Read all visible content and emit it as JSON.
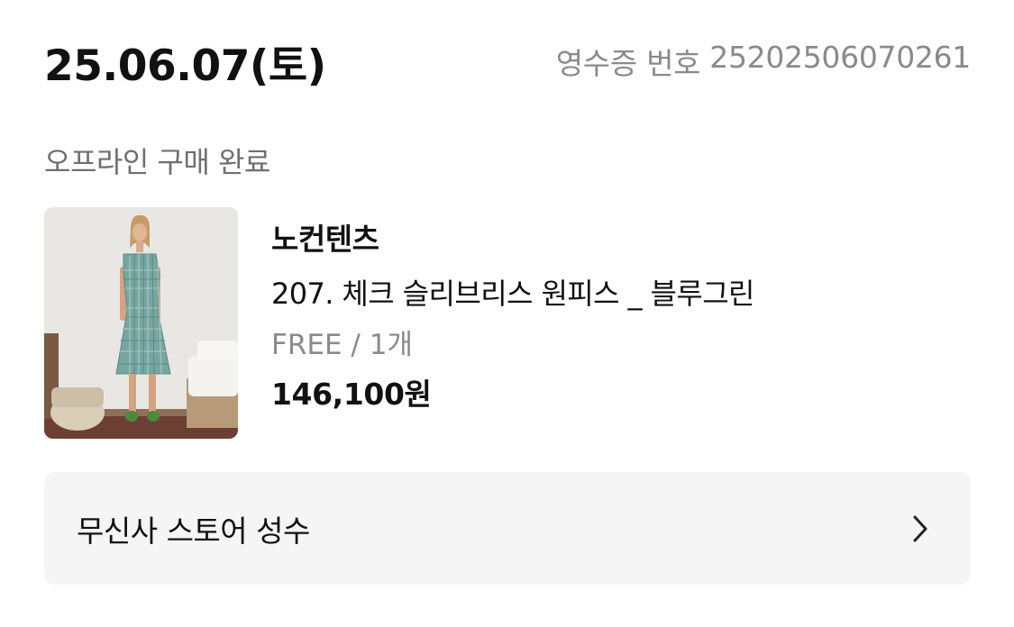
{
  "order": {
    "date": "25.06.07(토)",
    "receipt_label": "영수증 번호",
    "receipt_number": "25202506070261",
    "status": "오프라인 구매 완료"
  },
  "product": {
    "brand": "노컨텐츠",
    "name": "207. 체크 슬리브리스 원피스 _ 블루그린",
    "option_size": "FREE",
    "option_separator": "/",
    "option_quantity": "1개",
    "price": "146,100원"
  },
  "store": {
    "name": "무신사 스토어 성수",
    "icon": "chevron-right-icon"
  }
}
